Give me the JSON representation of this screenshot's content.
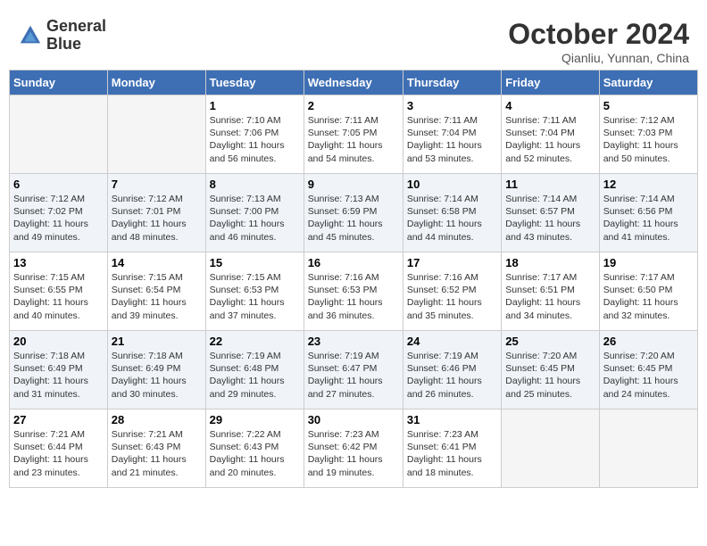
{
  "header": {
    "logo_line1": "General",
    "logo_line2": "Blue",
    "month": "October 2024",
    "location": "Qianliu, Yunnan, China"
  },
  "days_of_week": [
    "Sunday",
    "Monday",
    "Tuesday",
    "Wednesday",
    "Thursday",
    "Friday",
    "Saturday"
  ],
  "weeks": [
    [
      {
        "day": "",
        "sunrise": "",
        "sunset": "",
        "daylight": "",
        "empty": true
      },
      {
        "day": "",
        "sunrise": "",
        "sunset": "",
        "daylight": "",
        "empty": true
      },
      {
        "day": "1",
        "sunrise": "Sunrise: 7:10 AM",
        "sunset": "Sunset: 7:06 PM",
        "daylight": "Daylight: 11 hours and 56 minutes.",
        "empty": false
      },
      {
        "day": "2",
        "sunrise": "Sunrise: 7:11 AM",
        "sunset": "Sunset: 7:05 PM",
        "daylight": "Daylight: 11 hours and 54 minutes.",
        "empty": false
      },
      {
        "day": "3",
        "sunrise": "Sunrise: 7:11 AM",
        "sunset": "Sunset: 7:04 PM",
        "daylight": "Daylight: 11 hours and 53 minutes.",
        "empty": false
      },
      {
        "day": "4",
        "sunrise": "Sunrise: 7:11 AM",
        "sunset": "Sunset: 7:04 PM",
        "daylight": "Daylight: 11 hours and 52 minutes.",
        "empty": false
      },
      {
        "day": "5",
        "sunrise": "Sunrise: 7:12 AM",
        "sunset": "Sunset: 7:03 PM",
        "daylight": "Daylight: 11 hours and 50 minutes.",
        "empty": false
      }
    ],
    [
      {
        "day": "6",
        "sunrise": "Sunrise: 7:12 AM",
        "sunset": "Sunset: 7:02 PM",
        "daylight": "Daylight: 11 hours and 49 minutes.",
        "empty": false
      },
      {
        "day": "7",
        "sunrise": "Sunrise: 7:12 AM",
        "sunset": "Sunset: 7:01 PM",
        "daylight": "Daylight: 11 hours and 48 minutes.",
        "empty": false
      },
      {
        "day": "8",
        "sunrise": "Sunrise: 7:13 AM",
        "sunset": "Sunset: 7:00 PM",
        "daylight": "Daylight: 11 hours and 46 minutes.",
        "empty": false
      },
      {
        "day": "9",
        "sunrise": "Sunrise: 7:13 AM",
        "sunset": "Sunset: 6:59 PM",
        "daylight": "Daylight: 11 hours and 45 minutes.",
        "empty": false
      },
      {
        "day": "10",
        "sunrise": "Sunrise: 7:14 AM",
        "sunset": "Sunset: 6:58 PM",
        "daylight": "Daylight: 11 hours and 44 minutes.",
        "empty": false
      },
      {
        "day": "11",
        "sunrise": "Sunrise: 7:14 AM",
        "sunset": "Sunset: 6:57 PM",
        "daylight": "Daylight: 11 hours and 43 minutes.",
        "empty": false
      },
      {
        "day": "12",
        "sunrise": "Sunrise: 7:14 AM",
        "sunset": "Sunset: 6:56 PM",
        "daylight": "Daylight: 11 hours and 41 minutes.",
        "empty": false
      }
    ],
    [
      {
        "day": "13",
        "sunrise": "Sunrise: 7:15 AM",
        "sunset": "Sunset: 6:55 PM",
        "daylight": "Daylight: 11 hours and 40 minutes.",
        "empty": false
      },
      {
        "day": "14",
        "sunrise": "Sunrise: 7:15 AM",
        "sunset": "Sunset: 6:54 PM",
        "daylight": "Daylight: 11 hours and 39 minutes.",
        "empty": false
      },
      {
        "day": "15",
        "sunrise": "Sunrise: 7:15 AM",
        "sunset": "Sunset: 6:53 PM",
        "daylight": "Daylight: 11 hours and 37 minutes.",
        "empty": false
      },
      {
        "day": "16",
        "sunrise": "Sunrise: 7:16 AM",
        "sunset": "Sunset: 6:53 PM",
        "daylight": "Daylight: 11 hours and 36 minutes.",
        "empty": false
      },
      {
        "day": "17",
        "sunrise": "Sunrise: 7:16 AM",
        "sunset": "Sunset: 6:52 PM",
        "daylight": "Daylight: 11 hours and 35 minutes.",
        "empty": false
      },
      {
        "day": "18",
        "sunrise": "Sunrise: 7:17 AM",
        "sunset": "Sunset: 6:51 PM",
        "daylight": "Daylight: 11 hours and 34 minutes.",
        "empty": false
      },
      {
        "day": "19",
        "sunrise": "Sunrise: 7:17 AM",
        "sunset": "Sunset: 6:50 PM",
        "daylight": "Daylight: 11 hours and 32 minutes.",
        "empty": false
      }
    ],
    [
      {
        "day": "20",
        "sunrise": "Sunrise: 7:18 AM",
        "sunset": "Sunset: 6:49 PM",
        "daylight": "Daylight: 11 hours and 31 minutes.",
        "empty": false
      },
      {
        "day": "21",
        "sunrise": "Sunrise: 7:18 AM",
        "sunset": "Sunset: 6:49 PM",
        "daylight": "Daylight: 11 hours and 30 minutes.",
        "empty": false
      },
      {
        "day": "22",
        "sunrise": "Sunrise: 7:19 AM",
        "sunset": "Sunset: 6:48 PM",
        "daylight": "Daylight: 11 hours and 29 minutes.",
        "empty": false
      },
      {
        "day": "23",
        "sunrise": "Sunrise: 7:19 AM",
        "sunset": "Sunset: 6:47 PM",
        "daylight": "Daylight: 11 hours and 27 minutes.",
        "empty": false
      },
      {
        "day": "24",
        "sunrise": "Sunrise: 7:19 AM",
        "sunset": "Sunset: 6:46 PM",
        "daylight": "Daylight: 11 hours and 26 minutes.",
        "empty": false
      },
      {
        "day": "25",
        "sunrise": "Sunrise: 7:20 AM",
        "sunset": "Sunset: 6:45 PM",
        "daylight": "Daylight: 11 hours and 25 minutes.",
        "empty": false
      },
      {
        "day": "26",
        "sunrise": "Sunrise: 7:20 AM",
        "sunset": "Sunset: 6:45 PM",
        "daylight": "Daylight: 11 hours and 24 minutes.",
        "empty": false
      }
    ],
    [
      {
        "day": "27",
        "sunrise": "Sunrise: 7:21 AM",
        "sunset": "Sunset: 6:44 PM",
        "daylight": "Daylight: 11 hours and 23 minutes.",
        "empty": false
      },
      {
        "day": "28",
        "sunrise": "Sunrise: 7:21 AM",
        "sunset": "Sunset: 6:43 PM",
        "daylight": "Daylight: 11 hours and 21 minutes.",
        "empty": false
      },
      {
        "day": "29",
        "sunrise": "Sunrise: 7:22 AM",
        "sunset": "Sunset: 6:43 PM",
        "daylight": "Daylight: 11 hours and 20 minutes.",
        "empty": false
      },
      {
        "day": "30",
        "sunrise": "Sunrise: 7:23 AM",
        "sunset": "Sunset: 6:42 PM",
        "daylight": "Daylight: 11 hours and 19 minutes.",
        "empty": false
      },
      {
        "day": "31",
        "sunrise": "Sunrise: 7:23 AM",
        "sunset": "Sunset: 6:41 PM",
        "daylight": "Daylight: 11 hours and 18 minutes.",
        "empty": false
      },
      {
        "day": "",
        "sunrise": "",
        "sunset": "",
        "daylight": "",
        "empty": true
      },
      {
        "day": "",
        "sunrise": "",
        "sunset": "",
        "daylight": "",
        "empty": true
      }
    ]
  ]
}
